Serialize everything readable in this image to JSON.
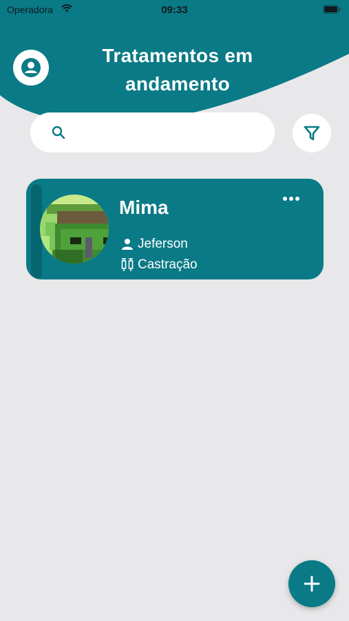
{
  "status_bar": {
    "carrier": "Operadora",
    "time": "09:33"
  },
  "header": {
    "title": "Tratamentos em andamento"
  },
  "search": {
    "placeholder": "",
    "value": ""
  },
  "colors": {
    "primary": "#0a7a86",
    "background": "#e8e8ea",
    "card_stripe": "#066670"
  },
  "treatments": [
    {
      "pet_name": "Mima",
      "owner": "Jeferson",
      "procedure": "Castração"
    }
  ],
  "icons": [
    "user-icon",
    "search-icon",
    "filter-icon",
    "more-icon",
    "owner-icon",
    "syringe-icon",
    "plus-icon",
    "wifi-icon",
    "battery-icon"
  ]
}
